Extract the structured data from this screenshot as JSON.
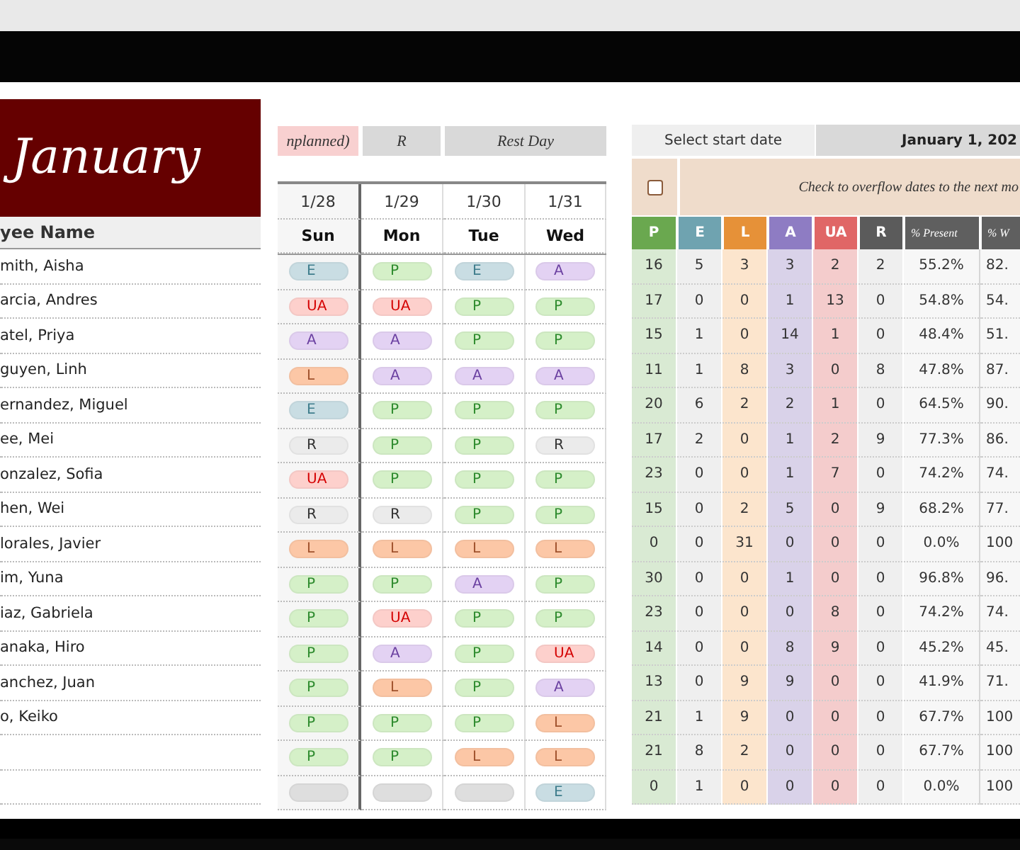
{
  "month_banner": {
    "title": "January"
  },
  "name_column": {
    "header": "yee Name"
  },
  "legend": [
    {
      "label": "nplanned)",
      "kind": "unplanned"
    },
    {
      "label": "R",
      "kind": "rest"
    },
    {
      "label": "Rest Day",
      "kind": "rest"
    }
  ],
  "days": [
    {
      "date": "1/28",
      "day": "Sun",
      "weekend": true
    },
    {
      "date": "1/29",
      "day": "Mon",
      "weekend": false
    },
    {
      "date": "1/30",
      "day": "Tue",
      "weekend": false
    },
    {
      "date": "1/31",
      "day": "Wed",
      "weekend": false
    }
  ],
  "rows": [
    {
      "name": "mith, Aisha",
      "marks": [
        {
          "kind": "early",
          "code": "E"
        },
        {
          "kind": "present",
          "code": "P"
        },
        {
          "kind": "early",
          "code": "E"
        },
        {
          "kind": "absent",
          "code": "A"
        }
      ]
    },
    {
      "name": "arcia, Andres",
      "marks": [
        {
          "kind": "unplanned",
          "code": "UA"
        },
        {
          "kind": "unplanned",
          "code": "UA"
        },
        {
          "kind": "present",
          "code": "P"
        },
        {
          "kind": "present",
          "code": "P"
        }
      ]
    },
    {
      "name": "atel, Priya",
      "marks": [
        {
          "kind": "absent",
          "code": "A"
        },
        {
          "kind": "absent",
          "code": "A"
        },
        {
          "kind": "present",
          "code": "P"
        },
        {
          "kind": "present",
          "code": "P"
        }
      ]
    },
    {
      "name": "guyen, Linh",
      "marks": [
        {
          "kind": "late",
          "code": "L"
        },
        {
          "kind": "absent",
          "code": "A"
        },
        {
          "kind": "absent",
          "code": "A"
        },
        {
          "kind": "absent",
          "code": "A"
        }
      ]
    },
    {
      "name": "ernandez, Miguel",
      "marks": [
        {
          "kind": "early",
          "code": "E"
        },
        {
          "kind": "present",
          "code": "P"
        },
        {
          "kind": "present",
          "code": "P"
        },
        {
          "kind": "present",
          "code": "P"
        }
      ]
    },
    {
      "name": "ee, Mei",
      "marks": [
        {
          "kind": "rest",
          "code": "R"
        },
        {
          "kind": "present",
          "code": "P"
        },
        {
          "kind": "present",
          "code": "P"
        },
        {
          "kind": "rest",
          "code": "R"
        }
      ]
    },
    {
      "name": "onzalez, Sofia",
      "marks": [
        {
          "kind": "unplanned",
          "code": "UA"
        },
        {
          "kind": "present",
          "code": "P"
        },
        {
          "kind": "present",
          "code": "P"
        },
        {
          "kind": "present",
          "code": "P"
        }
      ]
    },
    {
      "name": "hen, Wei",
      "marks": [
        {
          "kind": "rest",
          "code": "R"
        },
        {
          "kind": "rest",
          "code": "R"
        },
        {
          "kind": "present",
          "code": "P"
        },
        {
          "kind": "present",
          "code": "P"
        }
      ]
    },
    {
      "name": "lorales, Javier",
      "marks": [
        {
          "kind": "late",
          "code": "L"
        },
        {
          "kind": "late",
          "code": "L"
        },
        {
          "kind": "late",
          "code": "L"
        },
        {
          "kind": "late",
          "code": "L"
        }
      ]
    },
    {
      "name": "im, Yuna",
      "marks": [
        {
          "kind": "present",
          "code": "P"
        },
        {
          "kind": "present",
          "code": "P"
        },
        {
          "kind": "absent",
          "code": "A"
        },
        {
          "kind": "present",
          "code": "P"
        }
      ]
    },
    {
      "name": "iaz, Gabriela",
      "marks": [
        {
          "kind": "present",
          "code": "P"
        },
        {
          "kind": "unplanned",
          "code": "UA"
        },
        {
          "kind": "present",
          "code": "P"
        },
        {
          "kind": "present",
          "code": "P"
        }
      ]
    },
    {
      "name": "anaka, Hiro",
      "marks": [
        {
          "kind": "present",
          "code": "P"
        },
        {
          "kind": "absent",
          "code": "A"
        },
        {
          "kind": "present",
          "code": "P"
        },
        {
          "kind": "unplanned",
          "code": "UA"
        }
      ]
    },
    {
      "name": "anchez, Juan",
      "marks": [
        {
          "kind": "present",
          "code": "P"
        },
        {
          "kind": "late",
          "code": "L"
        },
        {
          "kind": "present",
          "code": "P"
        },
        {
          "kind": "absent",
          "code": "A"
        }
      ]
    },
    {
      "name": "o, Keiko",
      "marks": [
        {
          "kind": "present",
          "code": "P"
        },
        {
          "kind": "present",
          "code": "P"
        },
        {
          "kind": "present",
          "code": "P"
        },
        {
          "kind": "late",
          "code": "L"
        }
      ]
    },
    {
      "marks": [
        {
          "kind": "present",
          "code": "P"
        },
        {
          "kind": "present",
          "code": "P"
        },
        {
          "kind": "late",
          "code": "L"
        },
        {
          "kind": "late",
          "code": "L"
        }
      ]
    },
    {
      "marks": [
        {
          "kind": "blank"
        },
        {
          "kind": "blank"
        },
        {
          "kind": "blank"
        },
        {
          "kind": "early",
          "code": "E"
        }
      ]
    }
  ],
  "start_date": {
    "label": "Select start date",
    "value": "January 1, 202"
  },
  "overflow": {
    "checked": false,
    "label": "Check to overflow  dates to  the next mo"
  },
  "stats": {
    "columns": [
      {
        "label": "P",
        "color": "#6aa84f"
      },
      {
        "label": "E",
        "color": "#6fa3b0"
      },
      {
        "label": "L",
        "color": "#e69138"
      },
      {
        "label": "A",
        "color": "#8e7cc3"
      },
      {
        "label": "UA",
        "color": "#e06666"
      },
      {
        "label": "R",
        "color": "#5b5b5b"
      },
      {
        "label": "% Present",
        "color": "#5f5f5f"
      },
      {
        "label": "% W",
        "color": "#5f5f5f"
      }
    ],
    "rows": [
      [
        "16",
        "5",
        "3",
        "3",
        "2",
        "2",
        "55.2%",
        "82."
      ],
      [
        "17",
        "0",
        "0",
        "1",
        "13",
        "0",
        "54.8%",
        "54."
      ],
      [
        "15",
        "1",
        "0",
        "14",
        "1",
        "0",
        "48.4%",
        "51."
      ],
      [
        "11",
        "1",
        "8",
        "3",
        "0",
        "8",
        "47.8%",
        "87."
      ],
      [
        "20",
        "6",
        "2",
        "2",
        "1",
        "0",
        "64.5%",
        "90."
      ],
      [
        "17",
        "2",
        "0",
        "1",
        "2",
        "9",
        "77.3%",
        "86."
      ],
      [
        "23",
        "0",
        "0",
        "1",
        "7",
        "0",
        "74.2%",
        "74."
      ],
      [
        "15",
        "0",
        "2",
        "5",
        "0",
        "9",
        "68.2%",
        "77."
      ],
      [
        "0",
        "0",
        "31",
        "0",
        "0",
        "0",
        "0.0%",
        "100"
      ],
      [
        "30",
        "0",
        "0",
        "1",
        "0",
        "0",
        "96.8%",
        "96."
      ],
      [
        "23",
        "0",
        "0",
        "0",
        "8",
        "0",
        "74.2%",
        "74."
      ],
      [
        "14",
        "0",
        "0",
        "8",
        "9",
        "0",
        "45.2%",
        "45."
      ],
      [
        "13",
        "0",
        "9",
        "9",
        "0",
        "0",
        "41.9%",
        "71."
      ],
      [
        "21",
        "1",
        "9",
        "0",
        "0",
        "0",
        "67.7%",
        "100"
      ],
      [
        "21",
        "8",
        "2",
        "0",
        "0",
        "0",
        "67.7%",
        "100"
      ],
      [
        "0",
        "1",
        "0",
        "0",
        "0",
        "0",
        "0.0%",
        "100"
      ]
    ]
  }
}
